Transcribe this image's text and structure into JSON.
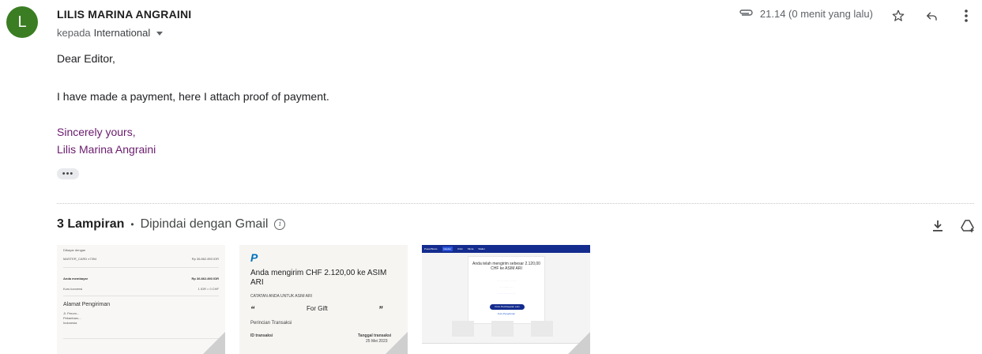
{
  "sender": {
    "avatar_letter": "L",
    "avatar_color": "#3b7d23",
    "name": "LILIS MARINA ANGRAINI"
  },
  "recipient": {
    "prefix": "kepada",
    "name": "International"
  },
  "meta": {
    "time": "21.14 (0 menit yang lalu)"
  },
  "icons": {
    "attachment": "paperclip-icon",
    "star": "star-icon",
    "reply": "reply-icon",
    "more": "more-vert-icon",
    "download": "download-icon",
    "drive": "add-to-drive-icon",
    "info": "info-icon"
  },
  "body": {
    "greeting": "Dear Editor,",
    "paragraph": "I have made a payment, here I attach proof of payment.",
    "closing": "Sincerely yours,",
    "signature_name": "Lilis Marina Angraini",
    "expand_dots": "•••"
  },
  "attachments": {
    "count_label": "3 Lampiran",
    "separator": "•",
    "scan_label": "Dipindai dengan Gmail",
    "thumb1": {
      "paid_with": "Dibayar dengan",
      "card": "MASTER_CARD x7394",
      "card_amount": "Rp 36.862.893 IDR",
      "you_paid": "Anda membayar",
      "you_paid_amount": "Rp 36.862.893 IDR",
      "rate": "Kurs konversi",
      "rate_value": "1 IDR = 0 CHF",
      "address_title": "Alamat Pengiriman",
      "address_lines": [
        "Jl. Perum...",
        "Pekanbaru...",
        "Indonesia"
      ]
    },
    "thumb2": {
      "logo": "P",
      "headline": "Anda mengirim CHF 2.120,00 ke ASIM ARI",
      "note_label": "CATATAN ANDA UNTUK ASIM ARI",
      "open_quote": "“",
      "gift": "For Gift",
      "close_quote": "”",
      "details": "Perincian Transaksi",
      "id_label": "ID transaksi",
      "date_label": "Tanggal transaksi",
      "date_value": "25 Mei 2023"
    },
    "thumb3": {
      "nav_items": [
        "Pusat Bisnis",
        "Dasbor",
        "Kirim",
        "Minta",
        "Wallet"
      ],
      "title": "Anda telah mengirim sebesar 2.120,00 CHF ke ASIM ARI",
      "button": "Kirim Pembayaran Lain",
      "link": "Kurs Pengiriman"
    }
  }
}
